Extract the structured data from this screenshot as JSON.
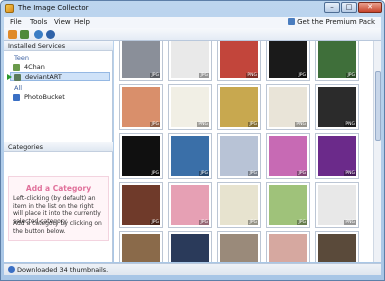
{
  "window": {
    "title": "The Image Collector"
  },
  "menu": {
    "items": [
      "File",
      "Tools",
      "View",
      "Help"
    ],
    "premium_label": "Get the Premium Pack"
  },
  "services": {
    "header": "Installed Services",
    "groups": [
      {
        "label": "Teen",
        "items": [
          "4Chan",
          "deviantART"
        ]
      },
      {
        "label": "All",
        "items": [
          "PhotoBucket"
        ]
      }
    ]
  },
  "categories": {
    "header": "Categories",
    "add_title": "Add a Category",
    "help_text": "Left-clicking (by default) an item in the list on the right will place it into the currently selected category.",
    "help_text2": "Add a category by clicking on the button below."
  },
  "thumbnails": [
    {
      "tag": "JPG",
      "color": "#8a8f99"
    },
    {
      "tag": "JPG",
      "color": "#e9e9e9"
    },
    {
      "tag": "PNG",
      "color": "#c2453b"
    },
    {
      "tag": "JPG",
      "color": "#1a1a1a"
    },
    {
      "tag": "JPG",
      "color": "#3f6f3a"
    },
    {
      "tag": "JPG",
      "color": "#d98f6b"
    },
    {
      "tag": "PNG",
      "color": "#f1efe5"
    },
    {
      "tag": "JPG",
      "color": "#c8a84f"
    },
    {
      "tag": "PNG",
      "color": "#e9e4d8"
    },
    {
      "tag": "PNG",
      "color": "#2b2b2b"
    },
    {
      "tag": "JPG",
      "color": "#101010"
    },
    {
      "tag": "JPG",
      "color": "#3a6fa8"
    },
    {
      "tag": "JPG",
      "color": "#b8c3d6"
    },
    {
      "tag": "JPG",
      "color": "#c76ab4"
    },
    {
      "tag": "PNG",
      "color": "#6b2a8a"
    },
    {
      "tag": "JPG",
      "color": "#6f3a2a"
    },
    {
      "tag": "JPG",
      "color": "#e6a0b4"
    },
    {
      "tag": "JPG",
      "color": "#e7e3cf"
    },
    {
      "tag": "JPG",
      "color": "#9fc27a"
    },
    {
      "tag": "PNG",
      "color": "#e8e8e8"
    },
    {
      "tag": "",
      "color": "#8a6a4a"
    },
    {
      "tag": "",
      "color": "#2a3a5a"
    },
    {
      "tag": "",
      "color": "#9a8a7a"
    },
    {
      "tag": "",
      "color": "#d6a8a0"
    },
    {
      "tag": "",
      "color": "#5a4a3a"
    }
  ],
  "status": {
    "text": "Downloaded 34 thumbnails."
  }
}
